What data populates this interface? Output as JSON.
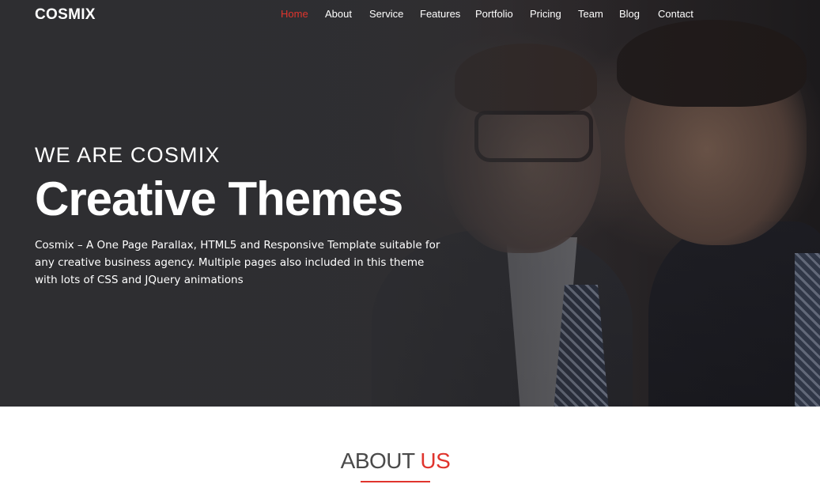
{
  "brand": {
    "name": "COSMIX"
  },
  "nav": {
    "items": [
      {
        "label": "Home",
        "active": true
      },
      {
        "label": "About",
        "active": false
      },
      {
        "label": "Service",
        "active": false
      },
      {
        "label": "Features",
        "active": false
      },
      {
        "label": "Portfolio",
        "active": false
      },
      {
        "label": "Pricing",
        "active": false
      },
      {
        "label": "Team",
        "active": false
      },
      {
        "label": "Blog",
        "active": false
      },
      {
        "label": "Contact",
        "active": false
      }
    ]
  },
  "hero": {
    "subtitle": "WE ARE COSMIX",
    "title": "Creative Themes",
    "description": "Cosmix – A One Page Parallax, HTML5 and Responsive Template suitable for any creative business agency. Multiple pages also included in this theme with lots of CSS and JQuery animations"
  },
  "about": {
    "heading_main": "ABOUT",
    "heading_accent": "US"
  },
  "colors": {
    "accent": "#e0342d",
    "hero_overlay": "#2d2d30",
    "heading_text": "#4a4a4a"
  }
}
